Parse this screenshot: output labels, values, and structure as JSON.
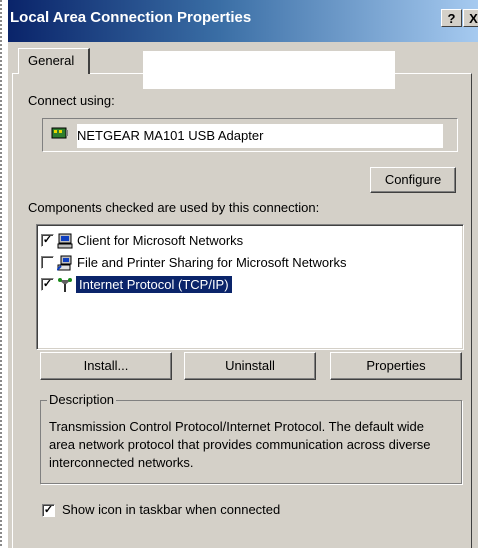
{
  "window": {
    "title": "Local Area Connection Properties",
    "help_button": "?",
    "close_button": "X"
  },
  "tabs": [
    {
      "label": "General"
    }
  ],
  "connect_using": {
    "label": "Connect using:",
    "adapter_name": "NETGEAR MA101 USB Adapter",
    "configure_button": "Configure"
  },
  "components": {
    "label": "Components checked are used by this connection:",
    "items": [
      {
        "label": "Client for Microsoft Networks",
        "checked": true,
        "icon": "network-client-icon",
        "selected": false
      },
      {
        "label": "File and Printer Sharing for Microsoft Networks",
        "checked": false,
        "icon": "file-printer-sharing-icon",
        "selected": false
      },
      {
        "label": "Internet Protocol (TCP/IP)",
        "checked": true,
        "icon": "protocol-icon",
        "selected": true
      }
    ],
    "install_button": "Install...",
    "uninstall_button": "Uninstall",
    "properties_button": "Properties"
  },
  "description": {
    "title": "Description",
    "text": "Transmission Control Protocol/Internet Protocol. The default wide area network protocol that provides communication across diverse interconnected networks."
  },
  "show_icon": {
    "label": "Show icon in taskbar when connected",
    "checked": true
  }
}
